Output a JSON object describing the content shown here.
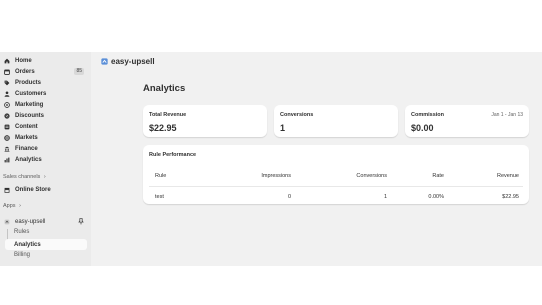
{
  "sidebar": {
    "items": [
      {
        "label": "Home",
        "icon": "home-icon"
      },
      {
        "label": "Orders",
        "icon": "orders-icon",
        "badge": "85"
      },
      {
        "label": "Products",
        "icon": "tag-icon"
      },
      {
        "label": "Customers",
        "icon": "person-icon"
      },
      {
        "label": "Marketing",
        "icon": "target-icon"
      },
      {
        "label": "Discounts",
        "icon": "discount-icon"
      },
      {
        "label": "Content",
        "icon": "content-icon"
      },
      {
        "label": "Markets",
        "icon": "globe-icon"
      },
      {
        "label": "Finance",
        "icon": "bank-icon"
      },
      {
        "label": "Analytics",
        "icon": "chart-icon"
      }
    ],
    "sales_channels_label": "Sales channels",
    "online_store_label": "Online Store",
    "apps_label": "Apps",
    "app_name": "easy-upsell",
    "app_sub_items": [
      {
        "label": "Rules"
      },
      {
        "label": "Analytics",
        "active": true
      },
      {
        "label": "Billing"
      }
    ]
  },
  "header": {
    "app_title": "easy-upsell"
  },
  "page": {
    "title": "Analytics",
    "stats": [
      {
        "label": "Total Revenue",
        "value": "$22.95"
      },
      {
        "label": "Conversions",
        "value": "1"
      },
      {
        "label": "Commission",
        "value": "$0.00",
        "range": "Jan 1 - Jan 13"
      }
    ],
    "performance": {
      "title": "Rule Performance",
      "columns": [
        "Rule",
        "Impressions",
        "Conversions",
        "Rate",
        "Revenue"
      ],
      "rows": [
        {
          "rule": "test",
          "impressions": "0",
          "conversions": "1",
          "rate": "0.00%",
          "revenue": "$22.95"
        }
      ]
    }
  },
  "colors": {
    "background": "#f1f1f1",
    "sidebar": "#ebebeb",
    "card": "#ffffff",
    "text": "#303030"
  }
}
